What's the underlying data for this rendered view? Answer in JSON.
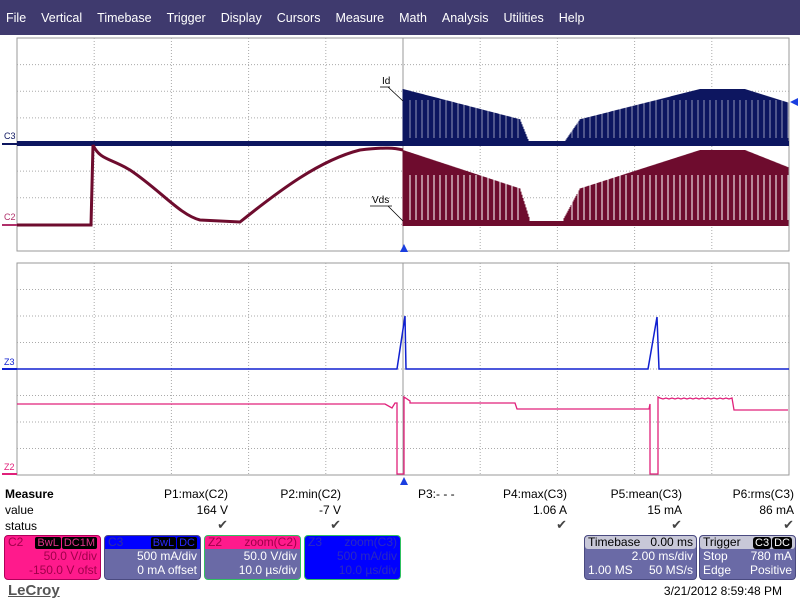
{
  "menu": [
    "File",
    "Vertical",
    "Timebase",
    "Trigger",
    "Display",
    "Cursors",
    "Measure",
    "Math",
    "Analysis",
    "Utilities",
    "Help"
  ],
  "traces": {
    "upper": {
      "c3_label": "C3",
      "c2_label": "C2",
      "annotation_id": "Id",
      "annotation_vds": "Vds"
    },
    "lower": {
      "z3_label": "Z3",
      "z2_label": "Z2"
    },
    "colors": {
      "c2": "#6e0c2e",
      "c3": "#0d1660",
      "z2": "#e0207a",
      "z3": "#1020d0",
      "grid": "#9a9a9a"
    }
  },
  "measure": {
    "title": "Measure",
    "row_labels": [
      "value",
      "status"
    ],
    "params": [
      {
        "name": "P1:max(C2)",
        "value": "164 V",
        "status": "✔"
      },
      {
        "name": "P2:min(C2)",
        "value": "-7 V",
        "status": "✔"
      },
      {
        "name": "P3:- - -",
        "value": "",
        "status": ""
      },
      {
        "name": "P4:max(C3)",
        "value": "1.06 A",
        "status": "✔"
      },
      {
        "name": "P5:mean(C3)",
        "value": "15 mA",
        "status": "✔"
      },
      {
        "name": "P6:rms(C3)",
        "value": "86 mA",
        "status": "✔"
      }
    ]
  },
  "channels": [
    {
      "id": "C2",
      "tags": [
        "BwL",
        "DC1M"
      ],
      "line1": "50.0 V/div",
      "line2": "-150.0 V ofst",
      "color": "#ff1a8c"
    },
    {
      "id": "C3",
      "tags": [
        "BwL",
        "DC"
      ],
      "line1": "500 mA/div",
      "line2": "0 mA offset",
      "color": "#0000ff"
    },
    {
      "id": "Z2",
      "source": "zoom(C2)",
      "line1": "50.0 V/div",
      "line2": "10.0 µs/div",
      "color": "#ff1a8c"
    },
    {
      "id": "Z3",
      "source": "zoom(C3)",
      "line1": "500 mA/div",
      "line2": "10.0 µs/div",
      "color": "#0000ff"
    }
  ],
  "timebase": {
    "label": "Timebase",
    "delay": "0.00 ms",
    "per_div": "2.00 ms/div",
    "samples": "1.00 MS",
    "rate": "50 MS/s"
  },
  "trigger": {
    "label": "Trigger",
    "source": "C3",
    "coupling": "DC",
    "mode": "Stop",
    "level": "780 mA",
    "type": "Edge",
    "slope": "Positive"
  },
  "brand": "LeCroy",
  "datetime": "3/21/2012 8:59:48 PM"
}
